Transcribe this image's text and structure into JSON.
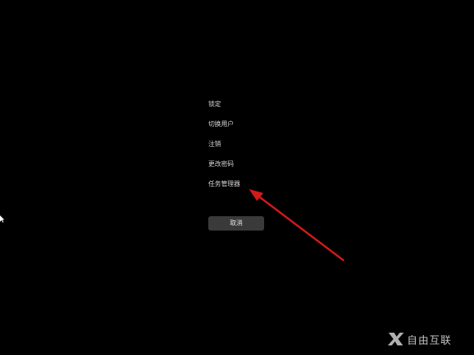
{
  "menu": {
    "items": [
      {
        "label": "锁定"
      },
      {
        "label": "切换用户"
      },
      {
        "label": "注销"
      },
      {
        "label": "更改密码"
      },
      {
        "label": "任务管理器"
      }
    ]
  },
  "cancel_label": "取消",
  "watermark": {
    "text": "自由互联"
  },
  "colors": {
    "background": "#000000",
    "text": "#d6d6d6",
    "button": "#3a3a3a",
    "annotation_arrow": "#d11a1a"
  },
  "icons": {
    "cursor": "mouse-cursor-icon",
    "arrow": "annotation-arrow-icon",
    "watermark": "watermark-logo-icon"
  }
}
